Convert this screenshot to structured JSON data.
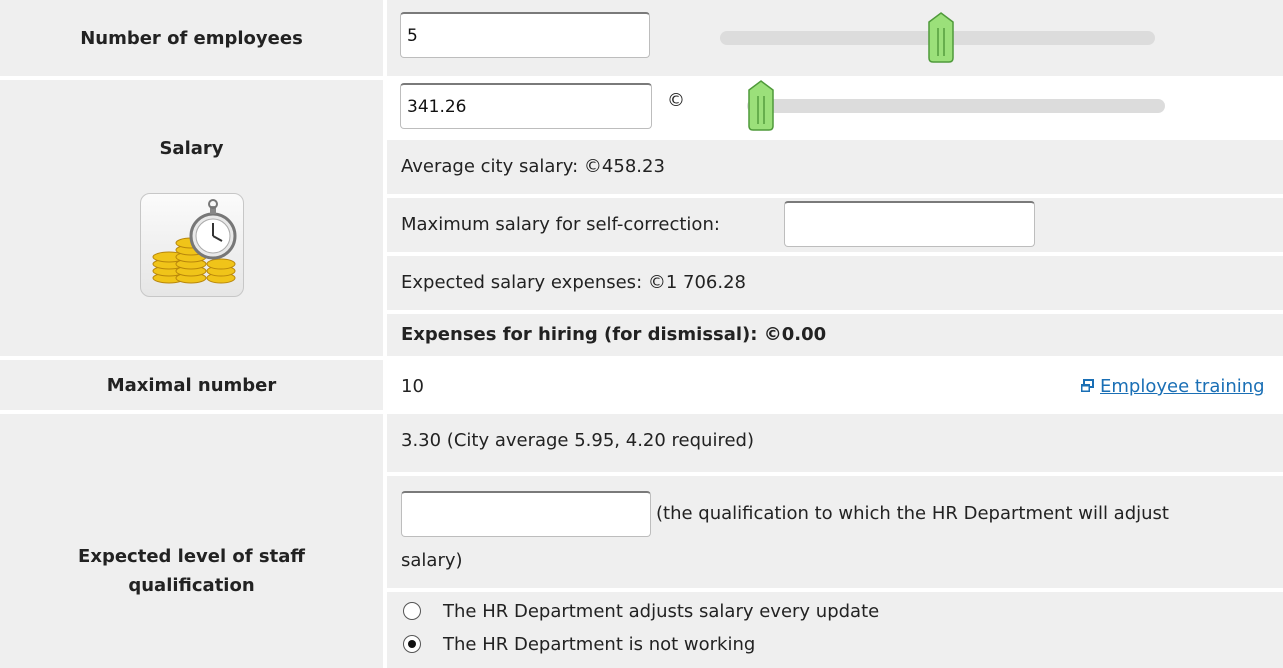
{
  "rows": {
    "employees": {
      "label": "Number of employees",
      "value": "5",
      "slider_level": 0.5
    },
    "salary": {
      "label": "Salary",
      "value": "341.26",
      "currency": "©",
      "slider_level": 0.03,
      "average_city_salary": "Average city salary: ©458.23",
      "max_self_correction_label": "Maximum salary for self-correction:",
      "max_self_correction_value": "",
      "expected_expenses": "Expected salary expenses: ©1 706.28",
      "hiring_expenses": "Expenses for hiring (for dismissal): ©0.00",
      "icon": "coins-stopwatch-icon"
    },
    "maximal": {
      "label": "Maximal number",
      "value": "10",
      "training_link": "Employee training"
    },
    "qualification": {
      "label": "Expected level of staff qualification",
      "summary": "3.30 (City average 5.95, 4.20 required)",
      "input_value": "",
      "hint": "(the qualification to which the HR Department will adjust",
      "hint_cont": "salary)",
      "options": [
        {
          "label": "The HR Department adjusts salary every update",
          "selected": false
        },
        {
          "label": "The HR Department is not working",
          "selected": true
        }
      ]
    }
  },
  "colors": {
    "row_bg": "#efefef",
    "slider_thumb": "#9be07a",
    "link": "#1a6fb5"
  }
}
